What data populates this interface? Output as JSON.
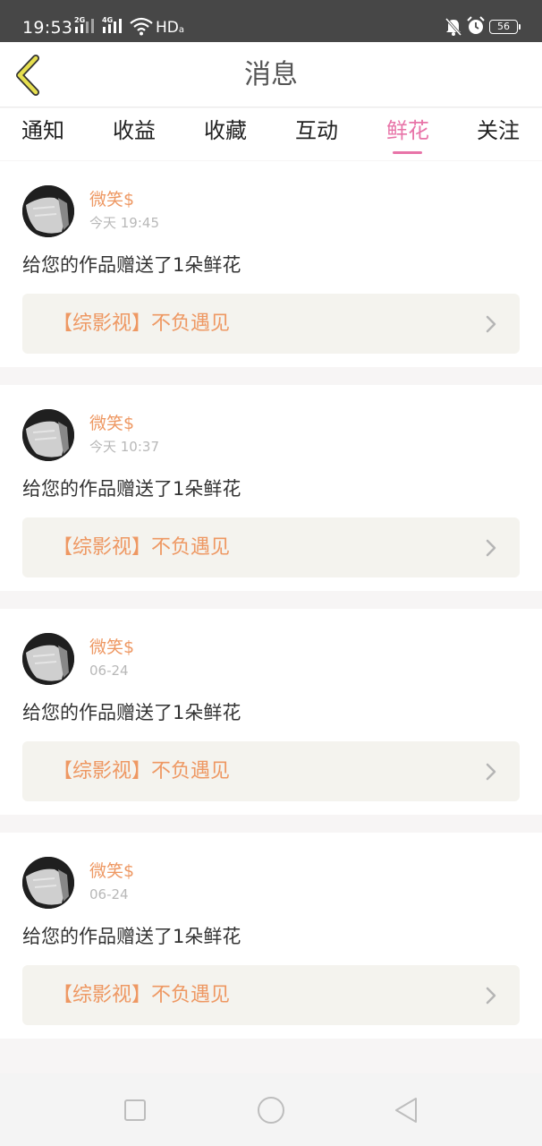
{
  "status_bar": {
    "time": "19:53",
    "signal1_label": "2G",
    "signal2_label": "4G",
    "network": "HD",
    "network_sub": "a",
    "battery": "56"
  },
  "header": {
    "title": "消息"
  },
  "tabs": [
    {
      "label": "通知",
      "active": false
    },
    {
      "label": "收益",
      "active": false
    },
    {
      "label": "收藏",
      "active": false
    },
    {
      "label": "互动",
      "active": false
    },
    {
      "label": "鲜花",
      "active": true
    },
    {
      "label": "关注",
      "active": false
    }
  ],
  "messages": [
    {
      "user": "微笑$",
      "time": "今天 19:45",
      "text": "给您的作品赠送了1朵鲜花",
      "work": "【综影视】不负遇见"
    },
    {
      "user": "微笑$",
      "time": "今天 10:37",
      "text": "给您的作品赠送了1朵鲜花",
      "work": "【综影视】不负遇见"
    },
    {
      "user": "微笑$",
      "time": "06-24",
      "text": "给您的作品赠送了1朵鲜花",
      "work": "【综影视】不负遇见"
    },
    {
      "user": "微笑$",
      "time": "06-24",
      "text": "给您的作品赠送了1朵鲜花",
      "work": "【综影视】不负遇见"
    }
  ],
  "colors": {
    "accent_pink": "#e874a8",
    "accent_orange": "#ee9863",
    "back_arrow": "#e6df4f"
  },
  "icons": {
    "back": "chevron-left-icon",
    "work_arrow": "chevron-right-icon",
    "nav_recent": "square-icon",
    "nav_home": "circle-icon",
    "nav_back": "triangle-back-icon"
  }
}
